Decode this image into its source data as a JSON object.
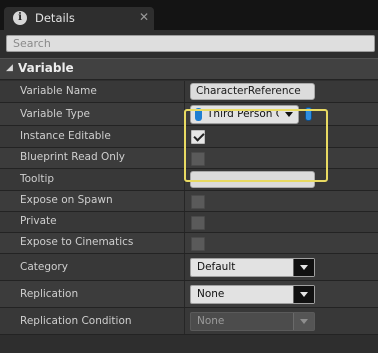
{
  "tab": {
    "icon": "info-icon",
    "icon_glyph": "i",
    "title": "Details",
    "close_glyph": "✕"
  },
  "search": {
    "placeholder": "Search"
  },
  "category": {
    "title": "Variable",
    "arrow_glyph": "◢"
  },
  "properties": {
    "variable_name": {
      "label": "Variable Name",
      "value": "CharacterReference"
    },
    "variable_type": {
      "label": "Variable Type",
      "value": "Third Person Ch",
      "type_color": "#1f7fd1",
      "container_icon": "single-variable-icon"
    },
    "instance_editable": {
      "label": "Instance Editable",
      "checked": true
    },
    "blueprint_read_only": {
      "label": "Blueprint Read Only",
      "checked": false
    },
    "tooltip": {
      "label": "Tooltip",
      "value": ""
    },
    "expose_on_spawn": {
      "label": "Expose on Spawn",
      "checked": false
    },
    "private": {
      "label": "Private",
      "checked": false
    },
    "expose_to_cinematics": {
      "label": "Expose to Cinematics",
      "checked": false
    },
    "category": {
      "label": "Category",
      "value": "Default"
    },
    "replication": {
      "label": "Replication",
      "value": "None"
    },
    "replication_condition": {
      "label": "Replication Condition",
      "value": "None",
      "disabled": true
    }
  },
  "colors": {
    "highlight": "#e8da62",
    "panel_bg": "#2e2e2e",
    "header_bg": "#414141",
    "accent_blue": "#1f7fd1"
  }
}
